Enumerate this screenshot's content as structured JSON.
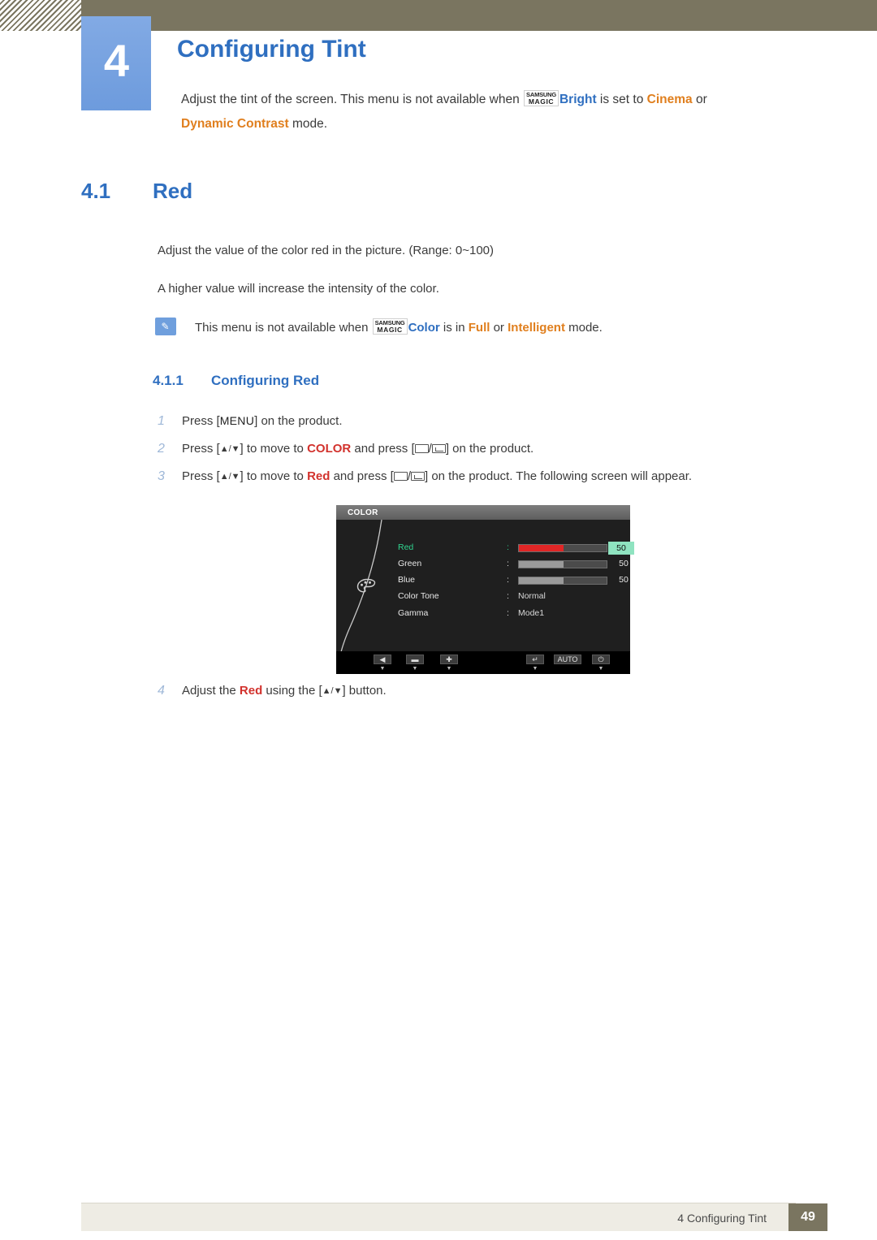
{
  "chapter": {
    "number": "4",
    "title": "Configuring Tint",
    "desc_pre": "Adjust the tint of the screen. This menu is not available when ",
    "magic_top": "SAMSUNG",
    "magic_bottom": "MAGIC",
    "desc_bright": "Bright",
    "desc_mid": " is set to ",
    "desc_cinema": "Cinema",
    "desc_or": " or ",
    "desc_dynamic": "Dynamic Contrast",
    "desc_end": " mode."
  },
  "section": {
    "number": "4.1",
    "title": "Red",
    "para1": "Adjust the value of the color red in the picture. (Range: 0~100)",
    "para2": "A higher value will increase the intensity of the color."
  },
  "note": {
    "icon": "note-icon",
    "pre": "This menu is not available when ",
    "magic_top": "SAMSUNG",
    "magic_bottom": "MAGIC",
    "color_word": "Color",
    "mid": " is in ",
    "full": "Full",
    "or": " or ",
    "intelligent": "Intelligent",
    "end": " mode."
  },
  "subsection": {
    "number": "4.1.1",
    "title": "Configuring Red"
  },
  "steps": [
    {
      "num": "1",
      "pre": "Press [",
      "key": "MENU",
      "post": "] on the product."
    },
    {
      "num": "2",
      "pre": "Press [",
      "arrows": "▲/▼",
      "mid1": "] to move to ",
      "target": "COLOR",
      "mid2": " and press [",
      "mid3": "/",
      "post": "] on the product."
    },
    {
      "num": "3",
      "pre": "Press [",
      "arrows": "▲/▼",
      "mid1": "] to move to ",
      "target": "Red",
      "mid2": " and press [",
      "mid3": "/",
      "post": "] on the product. The following screen will appear."
    },
    {
      "num": "4",
      "pre": "Adjust the ",
      "target": "Red",
      "mid1": " using the [",
      "arrows": "▲/▼",
      "post": "] button."
    }
  ],
  "osd": {
    "title": "COLOR",
    "icon": "palette-icon",
    "rows": [
      {
        "label": "Red",
        "colon": ":",
        "type": "bar",
        "fill_pct": 50,
        "value": "50",
        "active": true
      },
      {
        "label": "Green",
        "colon": ":",
        "type": "bar",
        "fill_pct": 50,
        "value": "50",
        "active": false
      },
      {
        "label": "Blue",
        "colon": ":",
        "type": "bar",
        "fill_pct": 50,
        "value": "50",
        "active": false
      },
      {
        "label": "Color Tone",
        "colon": ":",
        "type": "text",
        "value": "Normal",
        "active": false
      },
      {
        "label": "Gamma",
        "colon": ":",
        "type": "text",
        "value": "Mode1",
        "active": false
      }
    ],
    "footer": [
      {
        "glyph": "◀",
        "name": "left-button",
        "caret": "▼"
      },
      {
        "glyph": "▬",
        "name": "minus-button",
        "caret": "▼"
      },
      {
        "glyph": "✚",
        "name": "plus-button",
        "caret": "▼"
      },
      {
        "glyph": "↵",
        "name": "enter-button",
        "caret": "▼"
      },
      {
        "glyph": "AUTO",
        "name": "auto-button",
        "caret": ""
      },
      {
        "glyph": "⏻",
        "name": "power-button",
        "caret": "▼"
      }
    ]
  },
  "footer": {
    "text": "4 Configuring Tint",
    "page": "49"
  },
  "colors": {
    "accent_blue": "#2f6fc0",
    "orange": "#e07f1e",
    "band": "#7a7560",
    "osd_highlight": "#8fe3c0",
    "osd_red": "#e02626"
  }
}
